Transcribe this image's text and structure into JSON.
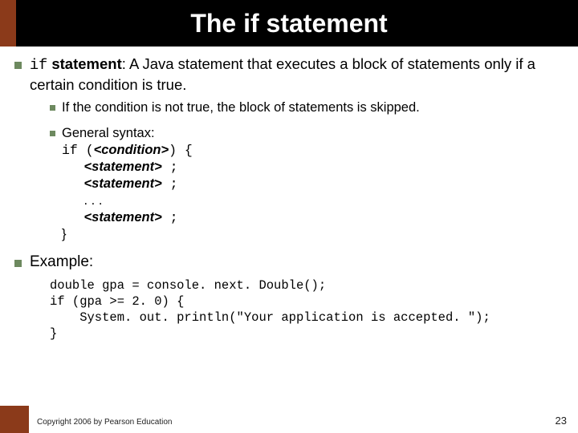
{
  "title": "The if statement",
  "main_bullet": {
    "code_word": "if",
    "bold_word": " statement",
    "rest": ": A Java statement that executes a block of statements only if a certain condition is true."
  },
  "sub_bullets": {
    "skip": "If the condition is not true, the block of statements is skipped.",
    "syntax_label": "General syntax:",
    "syntax": {
      "l1a": "if (",
      "l1b": "<condition>",
      "l1c": ") {",
      "stmt": "<statement>",
      "semi": " ;",
      "dots": ". . .",
      "close": "}"
    }
  },
  "example_label": "Example:",
  "code": {
    "l1": "double gpa = console. next. Double();",
    "l2": "if (gpa >= 2. 0) {",
    "l3": "    System. out. println(\"Your application is accepted. \");",
    "l4": "}"
  },
  "footer": "Copyright 2006 by Pearson Education",
  "page_num": "23"
}
